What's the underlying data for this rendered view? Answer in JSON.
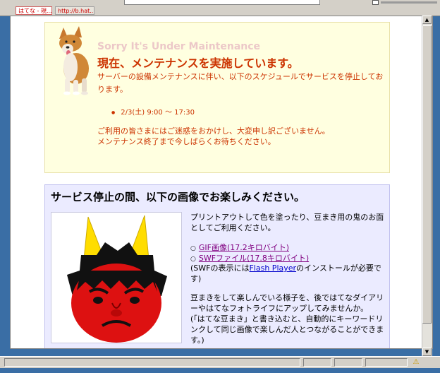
{
  "tabs": [
    {
      "label": "はてな - 現..."
    },
    {
      "label": "http://b.hat..."
    }
  ],
  "maintenance": {
    "sorry_banner": "Sorry It's Under Maintenance",
    "title": "現在、メンテナンスを実施しています。",
    "description": "サーバーの設備メンテナンスに伴い、以下のスケジュールでサービスを停止しております。",
    "schedule": [
      "2/3(土) 9:00 〜 17:30"
    ],
    "apology_line1": "ご利用の皆さまにはご迷惑をおかけし、大変申し訳ございません。",
    "apology_line2": "メンテナンス終了まで今しばらくお待ちください。"
  },
  "fun": {
    "title": "サービス停止の間、以下の画像でお楽しみください。",
    "description": "プリントアウトして色を塗ったり、豆まき用の鬼のお面としてご利用ください。",
    "links": [
      {
        "label": "GIF画像(17.2キロバイト)"
      },
      {
        "label": "SWFファイル(17.8キロバイト)"
      }
    ],
    "swf_note_prefix": "(SWFの表示には",
    "flash_link": "Flash Player",
    "swf_note_suffix": "のインストールが必要です)",
    "para1": "豆まきをして楽しんでいる様子を、後ではてなダイアリーやはてなフォトライフにアップしてみませんか。",
    "para2": "(「はてな豆まき」と書き込むと、自動的にキーワードリンクして同じ画像で楽しんだ人とつながることができます。)"
  },
  "colors": {
    "maintenance_bg": "#ffffe0",
    "maintenance_text": "#cc3300",
    "fun_bg": "#ebebff",
    "oni_red": "#dd1111",
    "horn_yellow": "#ffdd00"
  }
}
